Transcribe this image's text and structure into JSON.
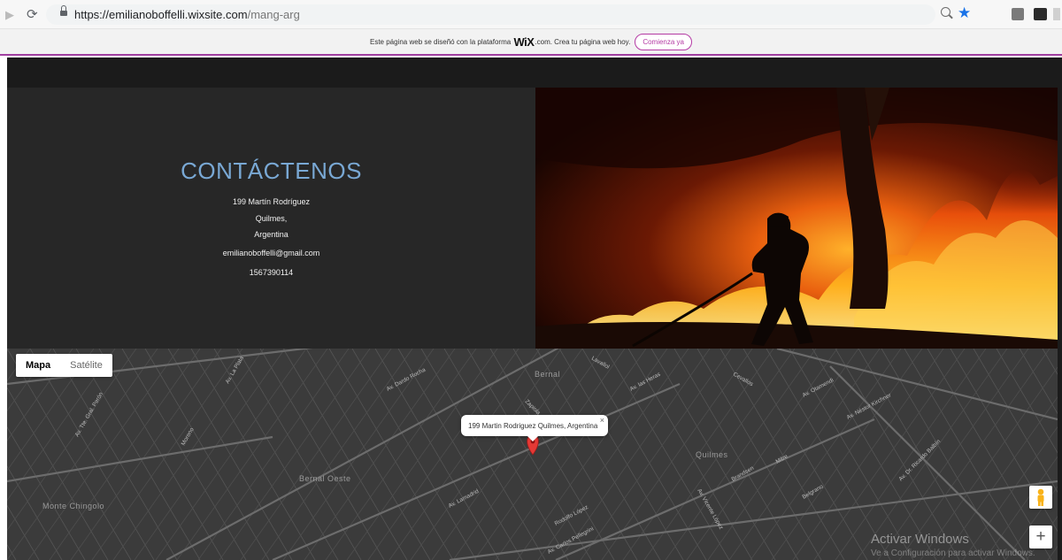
{
  "browser": {
    "url_domain": "https://emilianoboffelli.wixsite.com",
    "url_path": "/mang-arg",
    "icons": [
      "forward-icon",
      "reload-icon",
      "lock-icon",
      "zoom-icon",
      "star-icon",
      "extension-icon"
    ]
  },
  "wix_banner": {
    "text_before": "Este página web se diseñó con la plataforma",
    "logo": "WiX",
    "text_after": ".com. Crea tu página web hoy.",
    "button": "Comienza ya",
    "colors": {
      "accent": "#b43aa4"
    }
  },
  "contact": {
    "title": "CONTÁCTENOS",
    "address_line1": "199 Martín Rodríguez",
    "address_line2": "Quilmes,",
    "address_line3": "Argentina",
    "email": "emilianoboffelli@gmail.com",
    "phone": "1567390114",
    "colors": {
      "title": "#79a8d4",
      "panel": "#272727"
    }
  },
  "map": {
    "type_buttons": {
      "map": "Mapa",
      "satellite": "Satélite",
      "selected": "Mapa"
    },
    "info_window": "199 Martin Rodriguez Quilmes, Argentina",
    "info_close": "×",
    "zoom_in": "+",
    "areas": {
      "bernal": "Bernal",
      "bernal_oeste": "Bernal Oeste",
      "quilmes": "Quilmes",
      "monte_chingolo": "Monte Chingolo"
    },
    "streets": {
      "av_dardo_rocha": "Av. Dardo Rocha",
      "av_las_heras": "Av. las Heras",
      "av_lamadrid": "Av. Lamadrid",
      "av_vicente_lopez": "Av. Vicente López",
      "av_carlos_pellegrini": "Av. Carlos Pellegrini",
      "av_rodolfo_lopez": "Rodolfo López",
      "av_otamendi": "Av. Otamendi",
      "av_nestor_kirchner": "Av. Néstor Kirchner",
      "av_dr_ricardo_balbin": "Av. Dr. Ricardo Balbín",
      "av_la_plata": "Av. La Plata",
      "av_tte_gral_peron": "Av. Tte. Gral. Perón",
      "zapiola": "Zapiola",
      "lavallol": "Lavallol",
      "cevallos": "Cevallos",
      "mitre": "Mitre",
      "brandsen": "Brandsen",
      "moreno": "Moreno",
      "belgrano": "Belgrano"
    }
  },
  "watermark": {
    "title": "Activar Windows",
    "subtitle": "Ve a Configuración para activar Windows."
  }
}
